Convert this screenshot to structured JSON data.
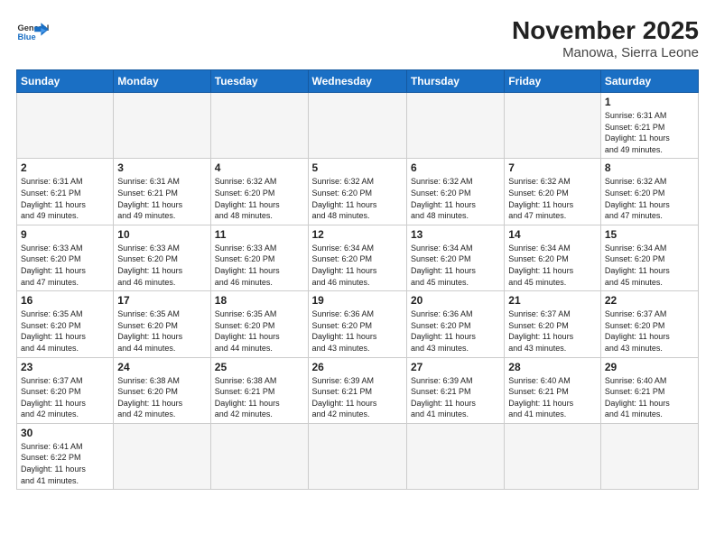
{
  "header": {
    "logo_text_normal": "General",
    "logo_text_blue": "Blue",
    "title": "November 2025",
    "subtitle": "Manowa, Sierra Leone"
  },
  "weekdays": [
    "Sunday",
    "Monday",
    "Tuesday",
    "Wednesday",
    "Thursday",
    "Friday",
    "Saturday"
  ],
  "weeks": [
    [
      {
        "day": "",
        "info": ""
      },
      {
        "day": "",
        "info": ""
      },
      {
        "day": "",
        "info": ""
      },
      {
        "day": "",
        "info": ""
      },
      {
        "day": "",
        "info": ""
      },
      {
        "day": "",
        "info": ""
      },
      {
        "day": "1",
        "info": "Sunrise: 6:31 AM\nSunset: 6:21 PM\nDaylight: 11 hours\nand 49 minutes."
      }
    ],
    [
      {
        "day": "2",
        "info": "Sunrise: 6:31 AM\nSunset: 6:21 PM\nDaylight: 11 hours\nand 49 minutes."
      },
      {
        "day": "3",
        "info": "Sunrise: 6:31 AM\nSunset: 6:21 PM\nDaylight: 11 hours\nand 49 minutes."
      },
      {
        "day": "4",
        "info": "Sunrise: 6:32 AM\nSunset: 6:20 PM\nDaylight: 11 hours\nand 48 minutes."
      },
      {
        "day": "5",
        "info": "Sunrise: 6:32 AM\nSunset: 6:20 PM\nDaylight: 11 hours\nand 48 minutes."
      },
      {
        "day": "6",
        "info": "Sunrise: 6:32 AM\nSunset: 6:20 PM\nDaylight: 11 hours\nand 48 minutes."
      },
      {
        "day": "7",
        "info": "Sunrise: 6:32 AM\nSunset: 6:20 PM\nDaylight: 11 hours\nand 47 minutes."
      },
      {
        "day": "8",
        "info": "Sunrise: 6:32 AM\nSunset: 6:20 PM\nDaylight: 11 hours\nand 47 minutes."
      }
    ],
    [
      {
        "day": "9",
        "info": "Sunrise: 6:33 AM\nSunset: 6:20 PM\nDaylight: 11 hours\nand 47 minutes."
      },
      {
        "day": "10",
        "info": "Sunrise: 6:33 AM\nSunset: 6:20 PM\nDaylight: 11 hours\nand 46 minutes."
      },
      {
        "day": "11",
        "info": "Sunrise: 6:33 AM\nSunset: 6:20 PM\nDaylight: 11 hours\nand 46 minutes."
      },
      {
        "day": "12",
        "info": "Sunrise: 6:34 AM\nSunset: 6:20 PM\nDaylight: 11 hours\nand 46 minutes."
      },
      {
        "day": "13",
        "info": "Sunrise: 6:34 AM\nSunset: 6:20 PM\nDaylight: 11 hours\nand 45 minutes."
      },
      {
        "day": "14",
        "info": "Sunrise: 6:34 AM\nSunset: 6:20 PM\nDaylight: 11 hours\nand 45 minutes."
      },
      {
        "day": "15",
        "info": "Sunrise: 6:34 AM\nSunset: 6:20 PM\nDaylight: 11 hours\nand 45 minutes."
      }
    ],
    [
      {
        "day": "16",
        "info": "Sunrise: 6:35 AM\nSunset: 6:20 PM\nDaylight: 11 hours\nand 44 minutes."
      },
      {
        "day": "17",
        "info": "Sunrise: 6:35 AM\nSunset: 6:20 PM\nDaylight: 11 hours\nand 44 minutes."
      },
      {
        "day": "18",
        "info": "Sunrise: 6:35 AM\nSunset: 6:20 PM\nDaylight: 11 hours\nand 44 minutes."
      },
      {
        "day": "19",
        "info": "Sunrise: 6:36 AM\nSunset: 6:20 PM\nDaylight: 11 hours\nand 43 minutes."
      },
      {
        "day": "20",
        "info": "Sunrise: 6:36 AM\nSunset: 6:20 PM\nDaylight: 11 hours\nand 43 minutes."
      },
      {
        "day": "21",
        "info": "Sunrise: 6:37 AM\nSunset: 6:20 PM\nDaylight: 11 hours\nand 43 minutes."
      },
      {
        "day": "22",
        "info": "Sunrise: 6:37 AM\nSunset: 6:20 PM\nDaylight: 11 hours\nand 43 minutes."
      }
    ],
    [
      {
        "day": "23",
        "info": "Sunrise: 6:37 AM\nSunset: 6:20 PM\nDaylight: 11 hours\nand 42 minutes."
      },
      {
        "day": "24",
        "info": "Sunrise: 6:38 AM\nSunset: 6:20 PM\nDaylight: 11 hours\nand 42 minutes."
      },
      {
        "day": "25",
        "info": "Sunrise: 6:38 AM\nSunset: 6:21 PM\nDaylight: 11 hours\nand 42 minutes."
      },
      {
        "day": "26",
        "info": "Sunrise: 6:39 AM\nSunset: 6:21 PM\nDaylight: 11 hours\nand 42 minutes."
      },
      {
        "day": "27",
        "info": "Sunrise: 6:39 AM\nSunset: 6:21 PM\nDaylight: 11 hours\nand 41 minutes."
      },
      {
        "day": "28",
        "info": "Sunrise: 6:40 AM\nSunset: 6:21 PM\nDaylight: 11 hours\nand 41 minutes."
      },
      {
        "day": "29",
        "info": "Sunrise: 6:40 AM\nSunset: 6:21 PM\nDaylight: 11 hours\nand 41 minutes."
      }
    ],
    [
      {
        "day": "30",
        "info": "Sunrise: 6:41 AM\nSunset: 6:22 PM\nDaylight: 11 hours\nand 41 minutes."
      },
      {
        "day": "",
        "info": ""
      },
      {
        "day": "",
        "info": ""
      },
      {
        "day": "",
        "info": ""
      },
      {
        "day": "",
        "info": ""
      },
      {
        "day": "",
        "info": ""
      },
      {
        "day": "",
        "info": ""
      }
    ]
  ]
}
